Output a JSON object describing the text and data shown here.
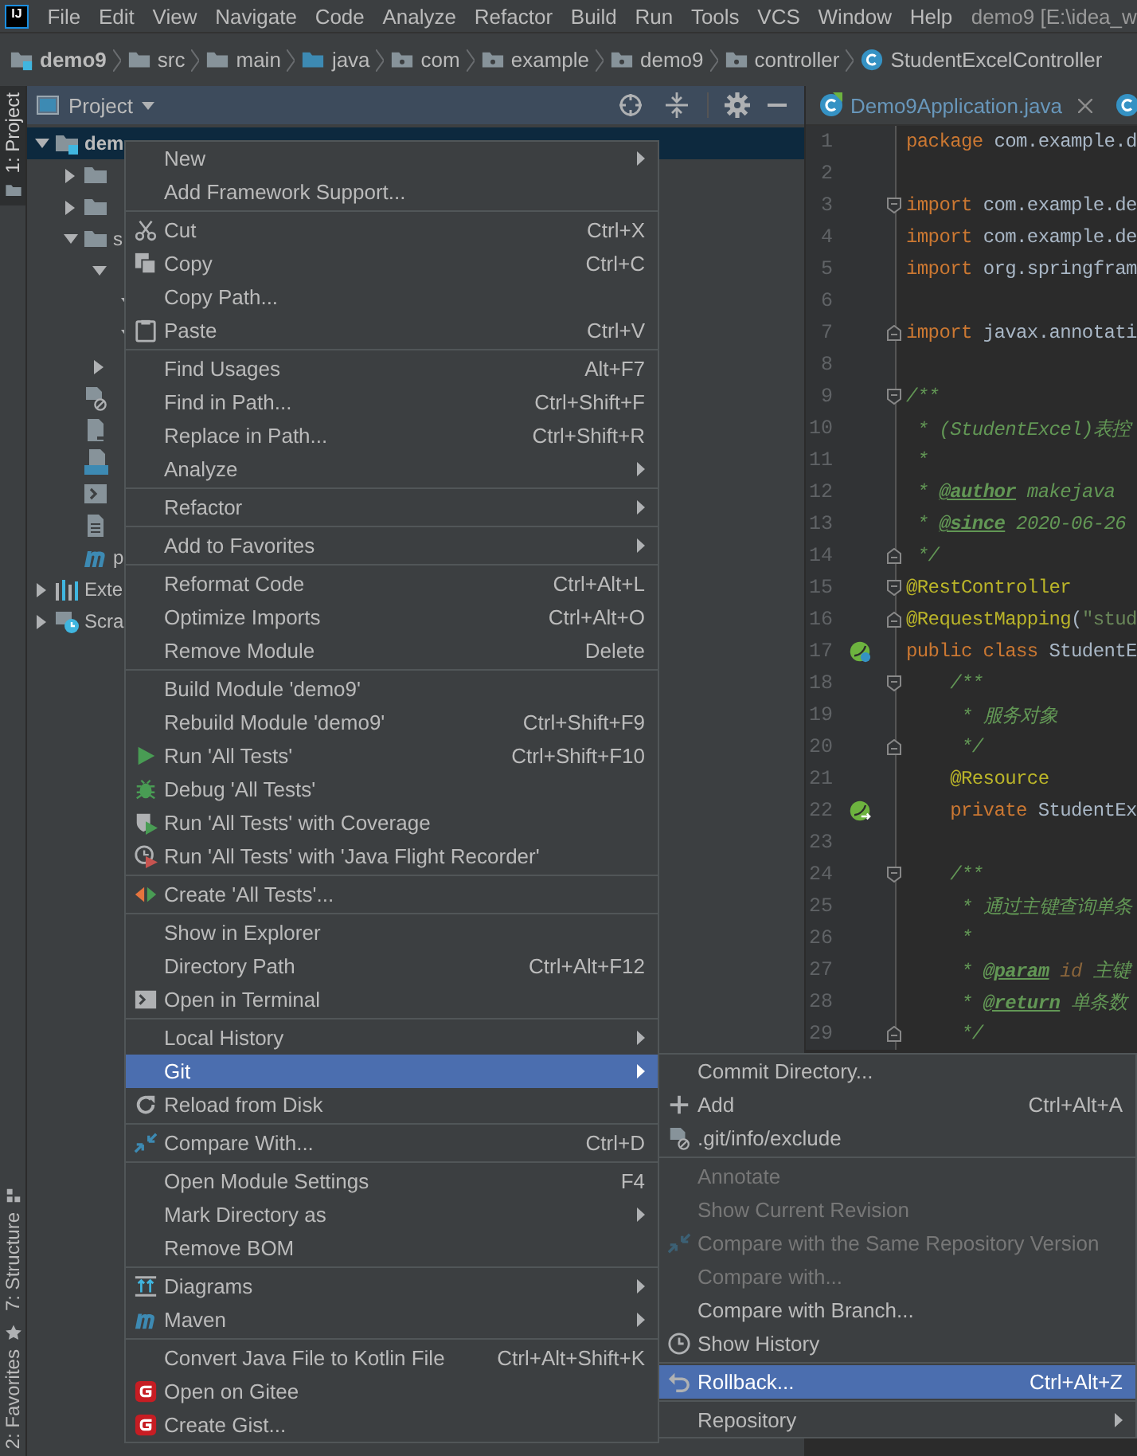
{
  "menubar": {
    "logo": "IJ",
    "menus": [
      "File",
      "Edit",
      "View",
      "Navigate",
      "Code",
      "Analyze",
      "Refactor",
      "Build",
      "Run",
      "Tools",
      "VCS",
      "Window",
      "Help"
    ],
    "title": "demo9 [E:\\idea_w"
  },
  "breadcrumbs": [
    {
      "label": "demo9",
      "kind": "module"
    },
    {
      "label": "src",
      "kind": "folder"
    },
    {
      "label": "main",
      "kind": "folder"
    },
    {
      "label": "java",
      "kind": "source"
    },
    {
      "label": "com",
      "kind": "package"
    },
    {
      "label": "example",
      "kind": "package"
    },
    {
      "label": "demo9",
      "kind": "package"
    },
    {
      "label": "controller",
      "kind": "package"
    },
    {
      "label": "StudentExcelController",
      "kind": "class"
    }
  ],
  "side_stripe": [
    {
      "label": "1: Project",
      "kind": "folder",
      "selected": true
    },
    {
      "label": "7: Structure",
      "kind": "structure",
      "selected": false
    },
    {
      "label": "2: Favorites",
      "kind": "star",
      "selected": false
    }
  ],
  "project": {
    "title": "Project",
    "tree": [
      {
        "name": "dem",
        "kind": "module",
        "expanded": true,
        "selected": true,
        "children": [
          {
            "kind": "folder",
            "expanded": false,
            "selected": false
          },
          {
            "kind": "folder",
            "expanded": false,
            "selected": false
          },
          {
            "name": "s",
            "kind": "folder",
            "expanded": true,
            "selected": false,
            "children": [
              {
                "expanded": true,
                "selected": false,
                "children": [
                  {
                    "expanded": true,
                    "selected": false
                  },
                  {
                    "expanded": true,
                    "selected": false
                  }
                ]
              },
              {
                "expanded": false,
                "selected": false
              }
            ]
          },
          {
            "kind": "ignore-file",
            "selected": false
          },
          {
            "kind": "file",
            "selected": false
          },
          {
            "kind": "md-file",
            "selected": false
          },
          {
            "kind": "script",
            "selected": false
          },
          {
            "kind": "text-file",
            "selected": false
          },
          {
            "name": "p",
            "kind": "maven",
            "selected": false
          }
        ]
      },
      {
        "name": "Exte",
        "kind": "libraries",
        "expanded": false,
        "selected": false
      },
      {
        "name": "Scra",
        "kind": "scratches",
        "expanded": false,
        "selected": false
      }
    ]
  },
  "editor": {
    "tabs": [
      {
        "label": "Demo9Application.java",
        "kind": "spring"
      },
      {
        "kind": "class"
      }
    ],
    "lines": [
      {
        "number": "1",
        "tokens": [
          {
            "kind": "keyword",
            "text": "package"
          },
          {
            "kind": "plain",
            "text": " com.example.d"
          }
        ]
      },
      {
        "number": "2"
      },
      {
        "number": "3",
        "fold": {
          "kind": "start"
        },
        "tokens": [
          {
            "kind": "keyword",
            "text": "import"
          },
          {
            "kind": "plain",
            "text": " com.example.de"
          }
        ]
      },
      {
        "number": "4",
        "tokens": [
          {
            "kind": "keyword",
            "text": "import"
          },
          {
            "kind": "plain",
            "text": " com.example.de"
          }
        ]
      },
      {
        "number": "5",
        "tokens": [
          {
            "kind": "keyword",
            "text": "import"
          },
          {
            "kind": "plain",
            "text": " org.springfram"
          }
        ]
      },
      {
        "number": "6"
      },
      {
        "number": "7",
        "fold": {
          "kind": "end"
        },
        "tokens": [
          {
            "kind": "keyword",
            "text": "import"
          },
          {
            "kind": "plain",
            "text": " javax.annotati"
          }
        ]
      },
      {
        "number": "8"
      },
      {
        "number": "9",
        "fold": {
          "kind": "start"
        },
        "tokens": [
          {
            "kind": "comment",
            "text": "/**"
          }
        ]
      },
      {
        "number": "10",
        "tokens": [
          {
            "kind": "comment",
            "text": " * (StudentExcel)表控"
          }
        ]
      },
      {
        "number": "11",
        "tokens": [
          {
            "kind": "comment",
            "text": " *"
          }
        ]
      },
      {
        "number": "12",
        "tokens": [
          {
            "kind": "comment",
            "text": " * "
          },
          {
            "kind": "doctag",
            "text": "@author"
          },
          {
            "kind": "comment",
            "text": " makejava"
          }
        ]
      },
      {
        "number": "13",
        "tokens": [
          {
            "kind": "comment",
            "text": " * "
          },
          {
            "kind": "doctag",
            "text": "@since"
          },
          {
            "kind": "comment",
            "text": " 2020-06-26"
          }
        ]
      },
      {
        "number": "14",
        "fold": {
          "kind": "end"
        },
        "tokens": [
          {
            "kind": "comment",
            "text": " */"
          }
        ]
      },
      {
        "number": "15",
        "fold": {
          "kind": "start"
        },
        "tokens": [
          {
            "kind": "annotation",
            "text": "@RestController"
          }
        ]
      },
      {
        "number": "16",
        "fold": {
          "kind": "end"
        },
        "tokens": [
          {
            "kind": "annotation",
            "text": "@RequestMapping"
          },
          {
            "kind": "plain",
            "text": "("
          },
          {
            "kind": "string",
            "text": "\"stud"
          }
        ]
      },
      {
        "number": "17",
        "gutter_icon": {
          "kind": "bean-class"
        },
        "tokens": [
          {
            "kind": "keyword",
            "text": "public class"
          },
          {
            "kind": "plain",
            "text": " StudentE"
          }
        ]
      },
      {
        "number": "18",
        "fold": {
          "kind": "start"
        },
        "tokens": [
          {
            "kind": "comment",
            "text": "    /**"
          }
        ]
      },
      {
        "number": "19",
        "tokens": [
          {
            "kind": "comment",
            "text": "     * 服务对象"
          }
        ]
      },
      {
        "number": "20",
        "fold": {
          "kind": "end"
        },
        "tokens": [
          {
            "kind": "comment",
            "text": "     */"
          }
        ]
      },
      {
        "number": "21",
        "tokens": [
          {
            "kind": "annotation",
            "text": "    @Resource"
          }
        ]
      },
      {
        "number": "22",
        "gutter_icon": {
          "kind": "bean-inject"
        },
        "tokens": [
          {
            "kind": "keyword",
            "text": "    private"
          },
          {
            "kind": "plain",
            "text": " StudentEx"
          }
        ]
      },
      {
        "number": "23"
      },
      {
        "number": "24",
        "fold": {
          "kind": "start"
        },
        "tokens": [
          {
            "kind": "comment",
            "text": "    /**"
          }
        ]
      },
      {
        "number": "25",
        "tokens": [
          {
            "kind": "comment",
            "text": "     * 通过主键查询单条"
          }
        ]
      },
      {
        "number": "26",
        "tokens": [
          {
            "kind": "comment",
            "text": "     *"
          }
        ]
      },
      {
        "number": "27",
        "tokens": [
          {
            "kind": "comment",
            "text": "     * "
          },
          {
            "kind": "doctag",
            "text": "@param"
          },
          {
            "kind": "param",
            "text": " id"
          },
          {
            "kind": "comment",
            "text": " 主键"
          }
        ]
      },
      {
        "number": "28",
        "tokens": [
          {
            "kind": "comment",
            "text": "     * "
          },
          {
            "kind": "doctag",
            "text": "@return"
          },
          {
            "kind": "comment",
            "text": " 单条数"
          }
        ]
      },
      {
        "number": "29",
        "fold": {
          "kind": "end"
        },
        "tokens": [
          {
            "kind": "comment",
            "text": "     */"
          }
        ]
      }
    ]
  },
  "context_menu": {
    "items": [
      {
        "kind": "plain",
        "label": "New",
        "submenu": true,
        "selected": false
      },
      {
        "kind": "plain",
        "label": "Add Framework Support...",
        "submenu": false,
        "selected": false
      },
      {
        "kind": "separator"
      },
      {
        "kind": "scissors",
        "label": "Cut",
        "shortcut": "Ctrl+X",
        "submenu": false,
        "selected": false
      },
      {
        "kind": "copy",
        "label": "Copy",
        "shortcut": "Ctrl+C",
        "submenu": false,
        "selected": false
      },
      {
        "kind": "plain",
        "label": "Copy Path...",
        "submenu": false,
        "selected": false
      },
      {
        "kind": "clipboard",
        "label": "Paste",
        "shortcut": "Ctrl+V",
        "submenu": false,
        "selected": false
      },
      {
        "kind": "separator"
      },
      {
        "kind": "plain",
        "label": "Find Usages",
        "shortcut": "Alt+F7",
        "submenu": false,
        "selected": false
      },
      {
        "kind": "plain",
        "label": "Find in Path...",
        "shortcut": "Ctrl+Shift+F",
        "submenu": false,
        "selected": false
      },
      {
        "kind": "plain",
        "label": "Replace in Path...",
        "shortcut": "Ctrl+Shift+R",
        "submenu": false,
        "selected": false
      },
      {
        "kind": "plain",
        "label": "Analyze",
        "submenu": true,
        "selected": false
      },
      {
        "kind": "separator"
      },
      {
        "kind": "plain",
        "label": "Refactor",
        "submenu": true,
        "selected": false
      },
      {
        "kind": "separator"
      },
      {
        "kind": "plain",
        "label": "Add to Favorites",
        "submenu": true,
        "selected": false
      },
      {
        "kind": "separator"
      },
      {
        "kind": "plain",
        "label": "Reformat Code",
        "shortcut": "Ctrl+Alt+L",
        "submenu": false,
        "selected": false
      },
      {
        "kind": "plain",
        "label": "Optimize Imports",
        "shortcut": "Ctrl+Alt+O",
        "submenu": false,
        "selected": false
      },
      {
        "kind": "plain",
        "label": "Remove Module",
        "shortcut": "Delete",
        "submenu": false,
        "selected": false
      },
      {
        "kind": "separator"
      },
      {
        "kind": "plain",
        "label": "Build Module 'demo9'",
        "submenu": false,
        "selected": false
      },
      {
        "kind": "plain",
        "label": "Rebuild Module 'demo9'",
        "shortcut": "Ctrl+Shift+F9",
        "submenu": false,
        "selected": false
      },
      {
        "kind": "run",
        "label": "Run 'All Tests'",
        "shortcut": "Ctrl+Shift+F10",
        "submenu": false,
        "selected": false
      },
      {
        "kind": "debug",
        "label": "Debug 'All Tests'",
        "submenu": false,
        "selected": false
      },
      {
        "kind": "coverage",
        "label": "Run 'All Tests' with Coverage",
        "submenu": false,
        "selected": false
      },
      {
        "kind": "profiler",
        "label": "Run 'All Tests' with 'Java Flight Recorder'",
        "submenu": false,
        "selected": false
      },
      {
        "kind": "separator"
      },
      {
        "kind": "create-test",
        "label": "Create 'All Tests'...",
        "submenu": false,
        "selected": false
      },
      {
        "kind": "separator"
      },
      {
        "kind": "plain",
        "label": "Show in Explorer",
        "submenu": false,
        "selected": false
      },
      {
        "kind": "plain",
        "label": "Directory Path",
        "shortcut": "Ctrl+Alt+F12",
        "submenu": false,
        "selected": false
      },
      {
        "kind": "terminal",
        "label": "Open in Terminal",
        "submenu": false,
        "selected": false
      },
      {
        "kind": "separator"
      },
      {
        "kind": "plain",
        "label": "Local History",
        "submenu": true,
        "selected": false
      },
      {
        "kind": "plain",
        "label": "Git",
        "submenu": true,
        "selected": true
      },
      {
        "kind": "reload",
        "label": "Reload from Disk",
        "submenu": false,
        "selected": false
      },
      {
        "kind": "separator"
      },
      {
        "kind": "compare",
        "label": "Compare With...",
        "shortcut": "Ctrl+D",
        "submenu": false,
        "selected": false
      },
      {
        "kind": "separator"
      },
      {
        "kind": "plain",
        "label": "Open Module Settings",
        "shortcut": "F4",
        "submenu": false,
        "selected": false
      },
      {
        "kind": "plain",
        "label": "Mark Directory as",
        "submenu": true,
        "selected": false
      },
      {
        "kind": "plain",
        "label": "Remove BOM",
        "submenu": false,
        "selected": false
      },
      {
        "kind": "separator"
      },
      {
        "kind": "diagram",
        "label": "Diagrams",
        "submenu": true,
        "selected": false
      },
      {
        "kind": "maven",
        "label": "Maven",
        "submenu": true,
        "selected": false
      },
      {
        "kind": "separator"
      },
      {
        "kind": "plain",
        "label": "Convert Java File to Kotlin File",
        "shortcut": "Ctrl+Alt+Shift+K",
        "submenu": false,
        "selected": false
      },
      {
        "kind": "gitee",
        "label": "Open on Gitee",
        "submenu": false,
        "selected": false
      },
      {
        "kind": "gitee",
        "label": "Create Gist...",
        "submenu": false,
        "selected": false
      }
    ]
  },
  "git_menu": {
    "items": [
      {
        "kind": "plain",
        "label": "Commit Directory...",
        "submenu": false,
        "selected": false,
        "disabled": false
      },
      {
        "kind": "plus",
        "label": "Add",
        "shortcut": "Ctrl+Alt+A",
        "submenu": false,
        "selected": false,
        "disabled": false
      },
      {
        "kind": "ignore-file",
        "label": ".git/info/exclude",
        "submenu": false,
        "selected": false,
        "disabled": false
      },
      {
        "kind": "separator"
      },
      {
        "kind": "plain",
        "label": "Annotate",
        "submenu": false,
        "selected": false,
        "disabled": true
      },
      {
        "kind": "plain",
        "label": "Show Current Revision",
        "submenu": false,
        "selected": false,
        "disabled": true
      },
      {
        "kind": "compare",
        "label": "Compare with the Same Repository Version",
        "submenu": false,
        "selected": false,
        "disabled": true
      },
      {
        "kind": "plain",
        "label": "Compare with...",
        "submenu": false,
        "selected": false,
        "disabled": true
      },
      {
        "kind": "plain",
        "label": "Compare with Branch...",
        "submenu": false,
        "selected": false,
        "disabled": false
      },
      {
        "kind": "clock",
        "label": "Show History",
        "submenu": false,
        "selected": false,
        "disabled": false
      },
      {
        "kind": "separator"
      },
      {
        "kind": "undo",
        "label": "Rollback...",
        "shortcut": "Ctrl+Alt+Z",
        "submenu": false,
        "selected": true,
        "disabled": false
      },
      {
        "kind": "separator"
      },
      {
        "kind": "plain",
        "label": "Repository",
        "submenu": true,
        "selected": false,
        "disabled": false
      }
    ]
  }
}
